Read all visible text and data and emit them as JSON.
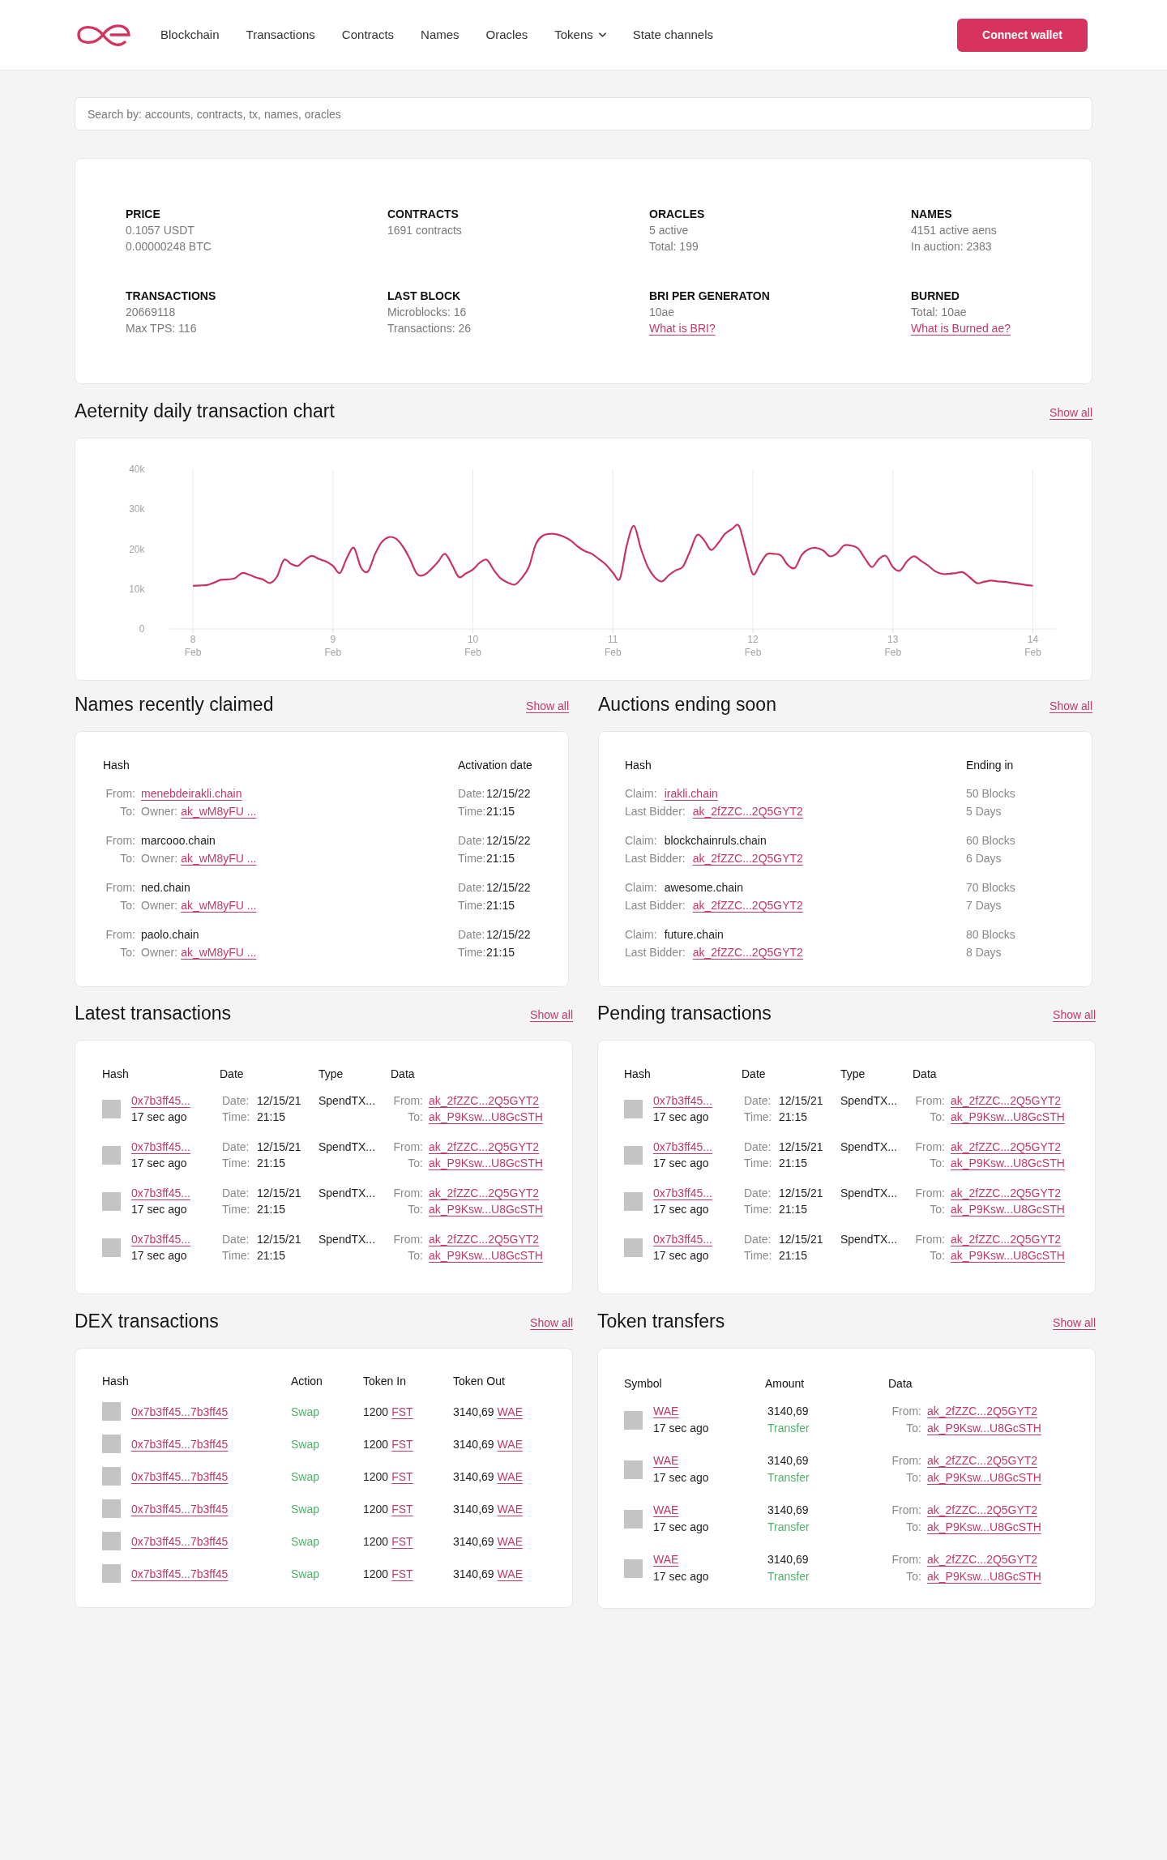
{
  "header": {
    "nav": [
      {
        "label": "Blockchain",
        "dropdown": false
      },
      {
        "label": "Transactions",
        "dropdown": false
      },
      {
        "label": "Contracts",
        "dropdown": false
      },
      {
        "label": "Names",
        "dropdown": false
      },
      {
        "label": "Oracles",
        "dropdown": false
      },
      {
        "label": "Tokens",
        "dropdown": true
      },
      {
        "label": "State channels",
        "dropdown": false
      }
    ],
    "connect_button": "Connect wallet"
  },
  "search": {
    "placeholder": "Search by: accounts, contracts, tx, names, oracles"
  },
  "stats": [
    {
      "title": "PRICE",
      "lines": [
        {
          "kind": "text",
          "text": "0.1057 USDT"
        },
        {
          "kind": "text",
          "text": "0.00000248 BTC"
        }
      ]
    },
    {
      "title": "CONTRACTS",
      "lines": [
        {
          "kind": "text",
          "text": "1691 contracts"
        }
      ]
    },
    {
      "title": "ORACLES",
      "lines": [
        {
          "kind": "text",
          "text": "5 active"
        },
        {
          "kind": "text",
          "text": "Total: 199"
        }
      ]
    },
    {
      "title": "NAMES",
      "lines": [
        {
          "kind": "text",
          "text": "4151 active aens"
        },
        {
          "kind": "text",
          "text": "In auction: 2383"
        }
      ]
    },
    {
      "title": "TRANSACTIONS",
      "lines": [
        {
          "kind": "text",
          "text": "20669118"
        },
        {
          "kind": "text",
          "text": "Max TPS: 116"
        }
      ]
    },
    {
      "title": "LAST BLOCK",
      "lines": [
        {
          "kind": "text",
          "text": "Microblocks: 16"
        },
        {
          "kind": "text",
          "text": "Transactions: 26"
        }
      ]
    },
    {
      "title": "BRI PER GENERATON",
      "lines": [
        {
          "kind": "text",
          "text": "10ae"
        },
        {
          "kind": "link",
          "text": "What is BRI?"
        }
      ]
    },
    {
      "title": "BURNED",
      "lines": [
        {
          "kind": "text",
          "text": "Total: 10ae"
        },
        {
          "kind": "link",
          "text": "What is Burned ae?"
        }
      ]
    }
  ],
  "transaction_chart": {
    "title": "Aeternity daily transaction chart",
    "show_all": "Show all",
    "chart_data": {
      "type": "line",
      "grid": true,
      "categories": [
        "8 Feb",
        null,
        null,
        null,
        null,
        null,
        null,
        null,
        null,
        null,
        null,
        null,
        null,
        null,
        null,
        null,
        null,
        null,
        null,
        null,
        "9 Feb",
        null,
        null,
        null,
        null,
        null,
        null,
        null,
        null,
        null,
        null,
        null,
        null,
        null,
        null,
        null,
        null,
        null,
        null,
        null,
        "10 Feb",
        null,
        null,
        null,
        null,
        null,
        null,
        null,
        null,
        null,
        null,
        null,
        null,
        null,
        null,
        null,
        null,
        null,
        null,
        null,
        "11 Feb",
        null,
        null,
        null,
        null,
        null,
        null,
        null,
        null,
        null,
        null,
        null,
        null,
        null,
        null,
        null,
        null,
        null,
        null,
        null,
        "12 Feb",
        null,
        null,
        null,
        null,
        null,
        null,
        null,
        null,
        null,
        null,
        null,
        null,
        null,
        null,
        null,
        null,
        null,
        null,
        null,
        "13 Feb",
        null,
        null,
        null,
        null,
        null,
        null,
        null,
        null,
        null,
        null,
        null,
        null,
        null,
        null,
        null,
        null,
        null,
        null,
        null,
        "14 Feb"
      ],
      "series": [
        {
          "color": "#c8345f",
          "values": [
            10800,
            10900,
            11000,
            11600,
            12300,
            12400,
            12700,
            14000,
            13600,
            12900,
            12400,
            11500,
            13100,
            17300,
            16300,
            15800,
            17300,
            18300,
            17500,
            16900,
            15800,
            14000,
            17800,
            20300,
            15400,
            14400,
            18700,
            21800,
            23000,
            22600,
            20600,
            17500,
            13800,
            13500,
            14900,
            16800,
            18800,
            16100,
            13000,
            13900,
            14900,
            16600,
            17300,
            14700,
            12600,
            11600,
            11100,
            12800,
            15600,
            21300,
            23400,
            23800,
            23700,
            23100,
            22100,
            20600,
            19500,
            18800,
            17500,
            16100,
            14100,
            12600,
            21100,
            25800,
            20100,
            15500,
            12900,
            11900,
            13500,
            14700,
            15600,
            19400,
            23500,
            22300,
            19800,
            21400,
            23800,
            25000,
            25800,
            19700,
            13700,
            16200,
            18700,
            18800,
            18400,
            16000,
            15300,
            18600,
            20000,
            20300,
            19700,
            18200,
            18900,
            20900,
            20900,
            20200,
            17700,
            15500,
            17500,
            18300,
            15500,
            14600,
            16900,
            18200,
            17100,
            15900,
            14500,
            13800,
            13800,
            14000,
            14200,
            12900,
            11500,
            11800,
            12100,
            11900,
            11800,
            11500,
            11300,
            11000,
            10800
          ]
        }
      ],
      "ylim": [
        0,
        40000
      ],
      "yticks": [
        {
          "value": 0,
          "label": "0"
        },
        {
          "value": 10000,
          "label": "10k"
        },
        {
          "value": 20000,
          "label": "20k"
        },
        {
          "value": 30000,
          "label": "30k"
        },
        {
          "value": 40000,
          "label": "40k"
        }
      ]
    }
  },
  "names_recently_claimed": {
    "title": "Names recently claimed",
    "show_all": "Show all",
    "columns": [
      "Hash",
      "Activation date"
    ],
    "rows": [
      {
        "from_label": "From:",
        "from": "menebdeirakli.chain",
        "from_is_link": true,
        "to_label": "To:",
        "owner_label": "Owner:",
        "owner": "ak_wM8yFU ...",
        "date_label": "Date:",
        "date": "12/15/22",
        "time_label": "Time:",
        "time": "21:15"
      },
      {
        "from_label": "From:",
        "from": "marcooo.chain",
        "from_is_link": false,
        "to_label": "To:",
        "owner_label": "Owner:",
        "owner": "ak_wM8yFU ...",
        "date_label": "Date:",
        "date": "12/15/22",
        "time_label": "Time:",
        "time": "21:15"
      },
      {
        "from_label": "From:",
        "from": "ned.chain",
        "from_is_link": false,
        "to_label": "To:",
        "owner_label": "Owner:",
        "owner": "ak_wM8yFU ...",
        "date_label": "Date:",
        "date": "12/15/22",
        "time_label": "Time:",
        "time": "21:15"
      },
      {
        "from_label": "From:",
        "from": "paolo.chain",
        "from_is_link": false,
        "to_label": "To:",
        "owner_label": "Owner:",
        "owner": "ak_wM8yFU ...",
        "date_label": "Date:",
        "date": "12/15/22",
        "time_label": "Time:",
        "time": "21:15"
      }
    ]
  },
  "auctions_ending_soon": {
    "title": "Auctions ending soon",
    "show_all": "Show all",
    "columns": [
      "Hash",
      "Ending in"
    ],
    "rows": [
      {
        "claim_label": "Claim:",
        "claim": "irakli.chain",
        "claim_is_link": true,
        "bidder_label": "Last Bidder:",
        "bidder": "ak_2fZZC...2Q5GYT2",
        "blocks": "50 Blocks",
        "days": "5 Days"
      },
      {
        "claim_label": "Claim:",
        "claim": "blockchainruls.chain",
        "claim_is_link": false,
        "bidder_label": "Last Bidder:",
        "bidder": "ak_2fZZC...2Q5GYT2",
        "blocks": "60 Blocks",
        "days": "6 Days"
      },
      {
        "claim_label": "Claim:",
        "claim": "awesome.chain",
        "claim_is_link": false,
        "bidder_label": "Last Bidder:",
        "bidder": "ak_2fZZC...2Q5GYT2",
        "blocks": "70 Blocks",
        "days": "7 Days"
      },
      {
        "claim_label": "Claim:",
        "claim": "future.chain",
        "claim_is_link": false,
        "bidder_label": "Last Bidder:",
        "bidder": "ak_2fZZC...2Q5GYT2",
        "blocks": "80 Blocks",
        "days": "8 Days"
      }
    ]
  },
  "latest_transactions": {
    "title": "Latest transactions",
    "show_all": "Show all",
    "columns": [
      "Hash",
      "Date",
      "Type",
      "Data"
    ],
    "rows": [
      {
        "hash": "0x7b3ff45...",
        "age": "17 sec ago",
        "date_label": "Date:",
        "date": "12/15/21",
        "time_label": "Time:",
        "time": "21:15",
        "type": "SpendTX...",
        "from_label": "From:",
        "from": "ak_2fZZC...2Q5GYT2",
        "to_label": "To:",
        "to": "ak_P9Ksw...U8GcSTH"
      },
      {
        "hash": "0x7b3ff45...",
        "age": "17 sec ago",
        "date_label": "Date:",
        "date": "12/15/21",
        "time_label": "Time:",
        "time": "21:15",
        "type": "SpendTX...",
        "from_label": "From:",
        "from": "ak_2fZZC...2Q5GYT2",
        "to_label": "To:",
        "to": "ak_P9Ksw...U8GcSTH"
      },
      {
        "hash": "0x7b3ff45...",
        "age": "17 sec ago",
        "date_label": "Date:",
        "date": "12/15/21",
        "time_label": "Time:",
        "time": "21:15",
        "type": "SpendTX...",
        "from_label": "From:",
        "from": "ak_2fZZC...2Q5GYT2",
        "to_label": "To:",
        "to": "ak_P9Ksw...U8GcSTH"
      },
      {
        "hash": "0x7b3ff45...",
        "age": "17 sec ago",
        "date_label": "Date:",
        "date": "12/15/21",
        "time_label": "Time:",
        "time": "21:15",
        "type": "SpendTX...",
        "from_label": "From:",
        "from": "ak_2fZZC...2Q5GYT2",
        "to_label": "To:",
        "to": "ak_P9Ksw...U8GcSTH"
      }
    ]
  },
  "pending_transactions": {
    "title": "Pending transactions",
    "show_all": "Show all",
    "columns": [
      "Hash",
      "Date",
      "Type",
      "Data"
    ],
    "rows": [
      {
        "hash": "0x7b3ff45...",
        "age": "17 sec ago",
        "date_label": "Date:",
        "date": "12/15/21",
        "time_label": "Time:",
        "time": "21:15",
        "type": "SpendTX...",
        "from_label": "From:",
        "from": "ak_2fZZC...2Q5GYT2",
        "to_label": "To:",
        "to": "ak_P9Ksw...U8GcSTH"
      },
      {
        "hash": "0x7b3ff45...",
        "age": "17 sec ago",
        "date_label": "Date:",
        "date": "12/15/21",
        "time_label": "Time:",
        "time": "21:15",
        "type": "SpendTX...",
        "from_label": "From:",
        "from": "ak_2fZZC...2Q5GYT2",
        "to_label": "To:",
        "to": "ak_P9Ksw...U8GcSTH"
      },
      {
        "hash": "0x7b3ff45...",
        "age": "17 sec ago",
        "date_label": "Date:",
        "date": "12/15/21",
        "time_label": "Time:",
        "time": "21:15",
        "type": "SpendTX...",
        "from_label": "From:",
        "from": "ak_2fZZC...2Q5GYT2",
        "to_label": "To:",
        "to": "ak_P9Ksw...U8GcSTH"
      },
      {
        "hash": "0x7b3ff45...",
        "age": "17 sec ago",
        "date_label": "Date:",
        "date": "12/15/21",
        "time_label": "Time:",
        "time": "21:15",
        "type": "SpendTX...",
        "from_label": "From:",
        "from": "ak_2fZZC...2Q5GYT2",
        "to_label": "To:",
        "to": "ak_P9Ksw...U8GcSTH"
      }
    ]
  },
  "dex_transactions": {
    "title": "DEX transactions",
    "show_all": "Show all",
    "columns": [
      "Hash",
      "Action",
      "Token In",
      "Token Out"
    ],
    "rows": [
      {
        "hash": "0x7b3ff45...7b3ff45",
        "action": "Swap",
        "amount_in": "1200",
        "token_in": "FST",
        "amount_out": "3140,69",
        "token_out": "WAE"
      },
      {
        "hash": "0x7b3ff45...7b3ff45",
        "action": "Swap",
        "amount_in": "1200",
        "token_in": "FST",
        "amount_out": "3140,69",
        "token_out": "WAE"
      },
      {
        "hash": "0x7b3ff45...7b3ff45",
        "action": "Swap",
        "amount_in": "1200",
        "token_in": "FST",
        "amount_out": "3140,69",
        "token_out": "WAE"
      },
      {
        "hash": "0x7b3ff45...7b3ff45",
        "action": "Swap",
        "amount_in": "1200",
        "token_in": "FST",
        "amount_out": "3140,69",
        "token_out": "WAE"
      },
      {
        "hash": "0x7b3ff45...7b3ff45",
        "action": "Swap",
        "amount_in": "1200",
        "token_in": "FST",
        "amount_out": "3140,69",
        "token_out": "WAE"
      },
      {
        "hash": "0x7b3ff45...7b3ff45",
        "action": "Swap",
        "amount_in": "1200",
        "token_in": "FST",
        "amount_out": "3140,69",
        "token_out": "WAE"
      }
    ]
  },
  "token_transfers": {
    "title": "Token transfers",
    "show_all": "Show all",
    "columns": [
      "Symbol",
      "Amount",
      "Data"
    ],
    "rows": [
      {
        "symbol": "WAE",
        "age": "17 sec ago",
        "amount": "3140,69",
        "type": "Transfer",
        "from_label": "From:",
        "from": "ak_2fZZC...2Q5GYT2",
        "to_label": "To:",
        "to": "ak_P9Ksw...U8GcSTH"
      },
      {
        "symbol": "WAE",
        "age": "17 sec ago",
        "amount": "3140,69",
        "type": "Transfer",
        "from_label": "From:",
        "from": "ak_2fZZC...2Q5GYT2",
        "to_label": "To:",
        "to": "ak_P9Ksw...U8GcSTH"
      },
      {
        "symbol": "WAE",
        "age": "17 sec ago",
        "amount": "3140,69",
        "type": "Transfer",
        "from_label": "From:",
        "from": "ak_2fZZC...2Q5GYT2",
        "to_label": "To:",
        "to": "ak_P9Ksw...U8GcSTH"
      },
      {
        "symbol": "WAE",
        "age": "17 sec ago",
        "amount": "3140,69",
        "type": "Transfer",
        "from_label": "From:",
        "from": "ak_2fZZC...2Q5GYT2",
        "to_label": "To:",
        "to": "ak_P9Ksw...U8GcSTH"
      }
    ]
  }
}
